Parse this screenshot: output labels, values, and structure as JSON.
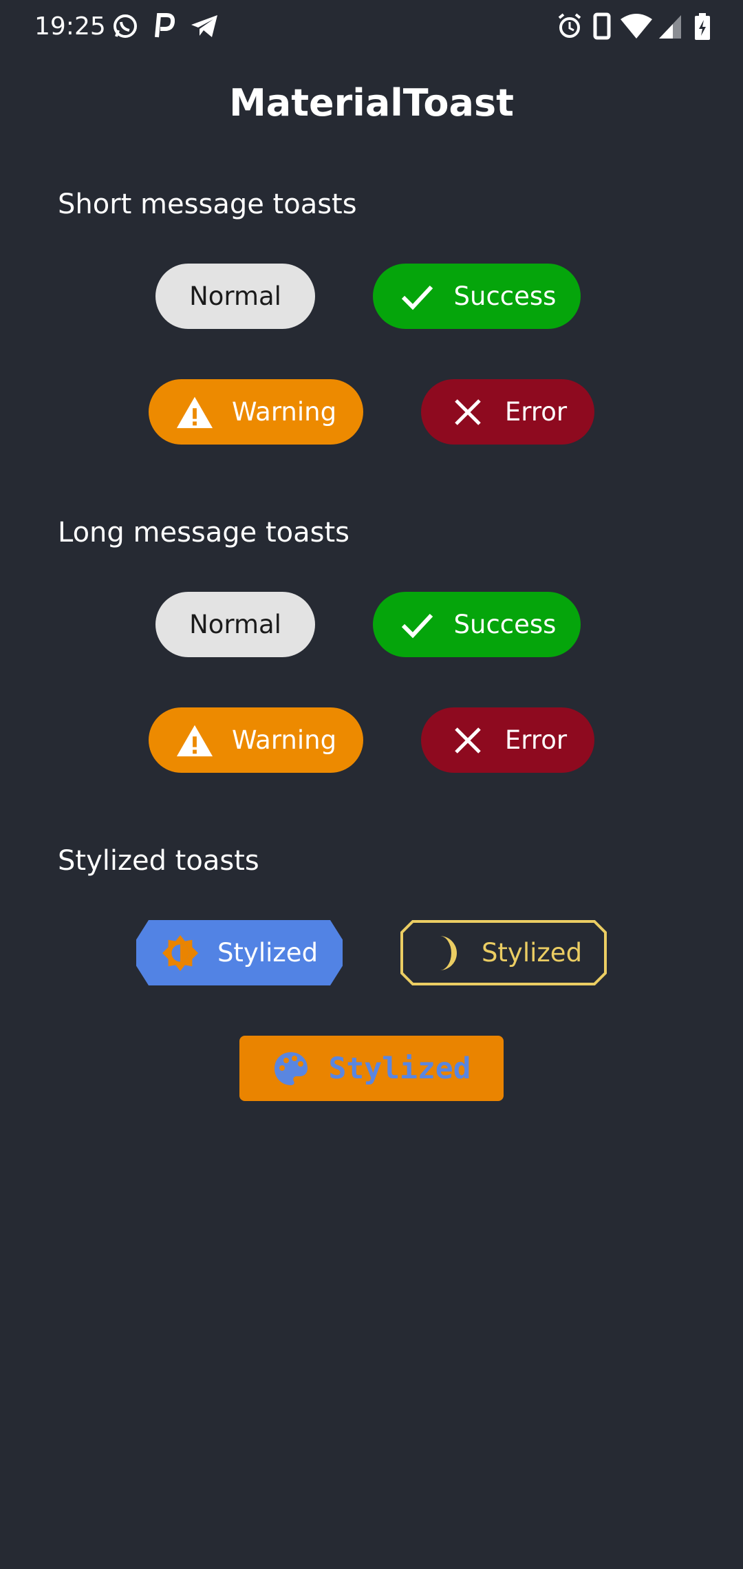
{
  "status_bar": {
    "time": "19:25",
    "left_icons": [
      "whatsapp-icon",
      "p-icon",
      "telegram-icon"
    ],
    "right_icons": [
      "alarm-icon",
      "phone-icon",
      "wifi-icon",
      "signal-icon",
      "battery-icon"
    ]
  },
  "app": {
    "title": "MaterialToast"
  },
  "sections": {
    "short": {
      "heading": "Short message toasts",
      "normal": "Normal",
      "success": "Success",
      "warning": "Warning",
      "error": "Error"
    },
    "long": {
      "heading": "Long message toasts",
      "normal": "Normal",
      "success": "Success",
      "warning": "Warning",
      "error": "Error"
    },
    "stylized": {
      "heading": "Stylized toasts",
      "blue_label": "Stylized",
      "dark_label": "Stylized",
      "orange_label": "Stylized"
    }
  },
  "colors": {
    "background": "#262a33",
    "normal": "#e3e3e3",
    "success": "#05a50b",
    "warning": "#ed8a00",
    "error": "#8e0a1f",
    "stylized_blue": "#5283e4",
    "stylized_dark_border": "#ebcd63",
    "stylized_orange": "#ea8400"
  }
}
